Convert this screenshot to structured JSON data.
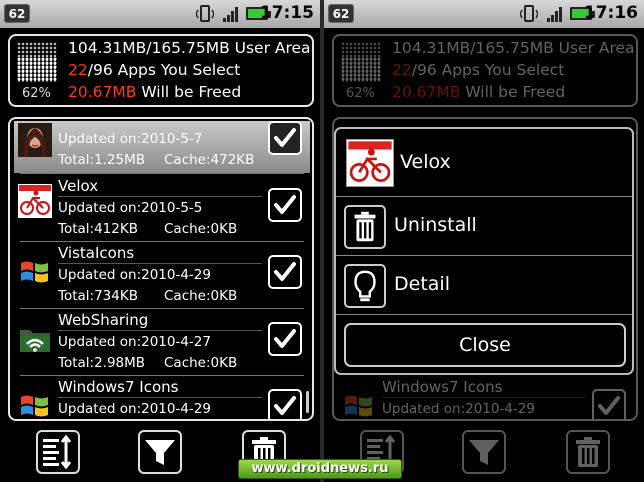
{
  "left": {
    "status": {
      "notif_count": "62",
      "time": "17:15"
    },
    "summary": {
      "storage_percent": "62%",
      "user_area": "104.31MB/165.75MB User Area",
      "apps_selected_count": "22",
      "apps_total_label": "/96 Apps You Select",
      "freed_amount": "20.67MB",
      "freed_label": " Will be Freed",
      "storage_used_fraction": 0.62
    },
    "apps": [
      {
        "name": "",
        "updated": "Updated on:2010-5-7",
        "total": "Total:1.25MB",
        "cache": "Cache:472KB",
        "checked": true,
        "highlighted": true
      },
      {
        "name": "Velox",
        "updated": "Updated on:2010-5-5",
        "total": "Total:412KB",
        "cache": "Cache:0KB",
        "checked": true
      },
      {
        "name": "VistaIcons",
        "updated": "Updated on:2010-4-29",
        "total": "Total:734KB",
        "cache": "Cache:0KB",
        "checked": true
      },
      {
        "name": "WebSharing",
        "updated": "Updated on:2010-4-27",
        "total": "Total:2.98MB",
        "cache": "Cache:0KB",
        "checked": true
      },
      {
        "name": "Windows7 Icons",
        "updated": "Updated on:2010-4-29",
        "total": "",
        "cache": "",
        "checked": true
      }
    ]
  },
  "right": {
    "status": {
      "notif_count": "62",
      "time": "17:16"
    },
    "dialog": {
      "title": "Velox",
      "items": [
        "Uninstall",
        "Detail"
      ],
      "close_label": "Close"
    }
  },
  "watermark": "www.droidnews.ru",
  "colors": {
    "accent_red": "#ff3a1a",
    "border": "#e8e8e8",
    "watermark_green": "#6fb82e"
  },
  "icons": {
    "toolbar": [
      "sort-icon",
      "filter-icon",
      "trash-icon"
    ],
    "apps": [
      "avatar-icon",
      "velox-bike-icon",
      "windows-flag-icon",
      "wifi-folder-icon",
      "windows-flag-icon"
    ]
  }
}
